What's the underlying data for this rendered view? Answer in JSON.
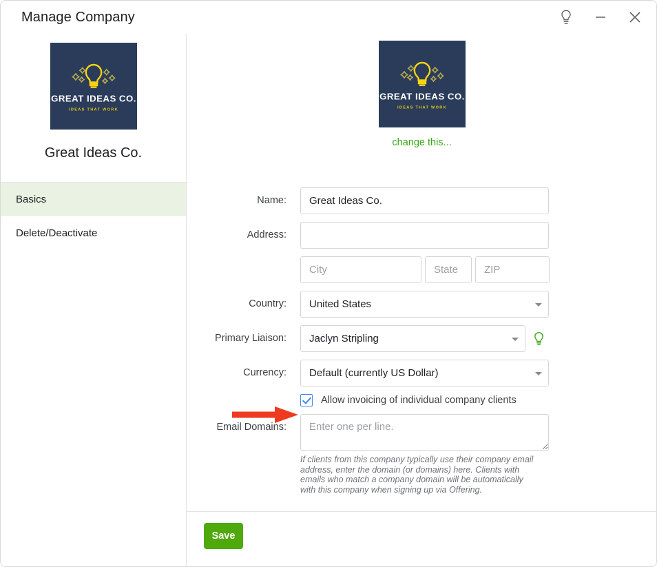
{
  "window": {
    "title": "Manage Company",
    "controls": [
      {
        "name": "help-bulb-icon",
        "label": "Help"
      },
      {
        "name": "minimize-icon",
        "label": "Minimize"
      },
      {
        "name": "close-icon",
        "label": "Close"
      }
    ]
  },
  "logo": {
    "brand_name": "GREAT IDEAS CO.",
    "tagline": "IDEAS THAT WORK",
    "background_color": "#2b3c5b",
    "bulb_color": "#f5d312",
    "text_color": "#ffffff",
    "tagline_color": "#e9c90f"
  },
  "sidebar": {
    "company_name": "Great Ideas Co.",
    "items": [
      {
        "label": "Basics",
        "selected": true
      },
      {
        "label": "Delete/Deactivate",
        "selected": false
      }
    ],
    "selected_background": "#eaf3e3"
  },
  "main": {
    "change_logo_link": "change this...",
    "link_color": "#3ba814",
    "fields": {
      "name": {
        "label": "Name:",
        "value": "Great Ideas Co.",
        "placeholder": ""
      },
      "address": {
        "label": "Address:",
        "value": "",
        "placeholder": ""
      },
      "city": {
        "value": "",
        "placeholder": "City"
      },
      "state": {
        "value": "",
        "placeholder": "State"
      },
      "zip": {
        "value": "",
        "placeholder": "ZIP"
      },
      "country": {
        "label": "Country:",
        "value": "United States"
      },
      "primary_liaison": {
        "label": "Primary Liaison:",
        "value": "Jaclyn Stripling",
        "help_icon": "bulb-icon",
        "help_icon_color": "#3ba814"
      },
      "currency": {
        "label": "Currency:",
        "value": "Default (currently US Dollar)"
      },
      "allow_invoicing": {
        "label": "Allow invoicing of individual company clients",
        "checked": true,
        "accent_color": "#4285f4"
      },
      "email_domains": {
        "label": "Email Domains:",
        "value": "",
        "placeholder": "Enter one per line.",
        "help_text": "If clients from this company typically use their company email address, enter the domain (or domains) here. Clients with emails who match a company domain will be automatically with this company when signing up via Offering."
      }
    },
    "save_label": "Save",
    "save_color": "#4fa80c"
  },
  "annotation": {
    "arrow_color": "#ee3a20",
    "points_to": "allow-invoicing-checkbox"
  }
}
